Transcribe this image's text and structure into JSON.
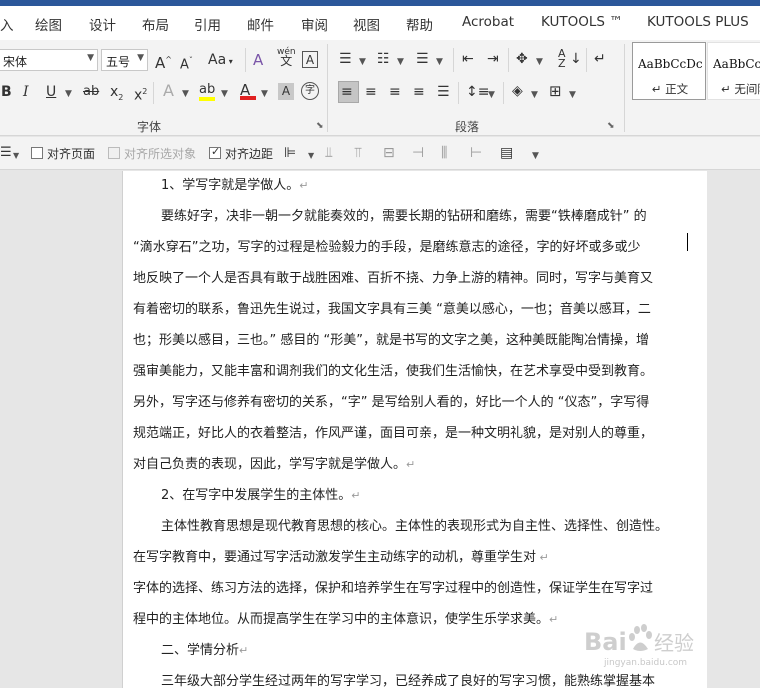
{
  "menu": {
    "tabs": [
      "入",
      "绘图",
      "设计",
      "布局",
      "引用",
      "邮件",
      "审阅",
      "视图",
      "帮助",
      "Acrobat",
      "KUTOOLS ™",
      "KUTOOLS PLUS"
    ]
  },
  "ribbon": {
    "font_name": "宋体",
    "font_size": "五号",
    "font_group_label": "字体",
    "paragraph_group_label": "段落",
    "icons": {
      "grow_font": "A",
      "shrink_font": "A",
      "change_case": "Aa",
      "clear_format": "A",
      "phonetic": "wén",
      "border_char": "A",
      "bold": "B",
      "italic": "I",
      "underline": "U",
      "strike": "ab",
      "subscript": "x",
      "superscript": "x",
      "text_effect": "A",
      "highlight": "ab",
      "font_color": "A",
      "char_shading": "A",
      "enclose_char": "字"
    },
    "styles": [
      {
        "sample": "AaBbCcDc",
        "name": "↵ 正文"
      },
      {
        "sample": "AaBbCcI",
        "name": "↵ 无间隔"
      }
    ]
  },
  "toolbar2": {
    "align_page": "对齐页面",
    "align_selected": "对齐所选对象",
    "align_margin": "对齐边距"
  },
  "document": {
    "paragraphs": [
      "1、学写字就是学做人。",
      "要练好字，决非一朝一夕就能奏效的，需要长期的钻研和磨练，需要“铁棒磨成针” 的",
      "“滴水穿石”之功，写字的过程是检验毅力的手段，是磨练意志的途径，字的好坏或多或少",
      "地反映了一个人是否具有敢于战胜困难、百折不挠、力争上游的精神。同时，写字与美育又",
      "有着密切的联系，鲁迅先生说过，我国文字具有三美 “意美以感心，一也；音美以感耳，二",
      "也；形美以感目，三也。” 感目的 “形美”，就是书写的文字之美，这种美既能陶冶情操，增",
      "强审美能力，又能丰富和调剂我们的文化生活，使我们生活愉快，在艺术享受中受到教育。",
      "另外，写字还与修养有密切的关系，“字” 是写给别人看的，好比一个人的 “仪态”，字写得",
      "规范端正，好比人的衣着整洁，作风严谨，面目可亲，是一种文明礼貌，是对别人的尊重，",
      "对自己负责的表现，因此，学写字就是学做人。",
      "2、在写字中发展学生的主体性。",
      "主体性教育思想是现代教育思想的核心。主体性的表现形式为自主性、选择性、创造性。",
      "在写字教育中，要通过写字活动激发学生主动练字的动机，尊重学生对",
      "字体的选择、练习方法的选择，保护和培养学生在写字过程中的创造性，保证学生在写字过",
      "程中的主体地位。从而提高学生在学习中的主体意识，使学生乐学求美。",
      "二、学情分析",
      "三年级大部分学生经过两年的写字学习，已经养成了良好的写字习惯，能熟练掌握基本"
    ]
  },
  "watermark": {
    "text": "Bai 经验",
    "subtext": "jingyan.baidu.com"
  }
}
